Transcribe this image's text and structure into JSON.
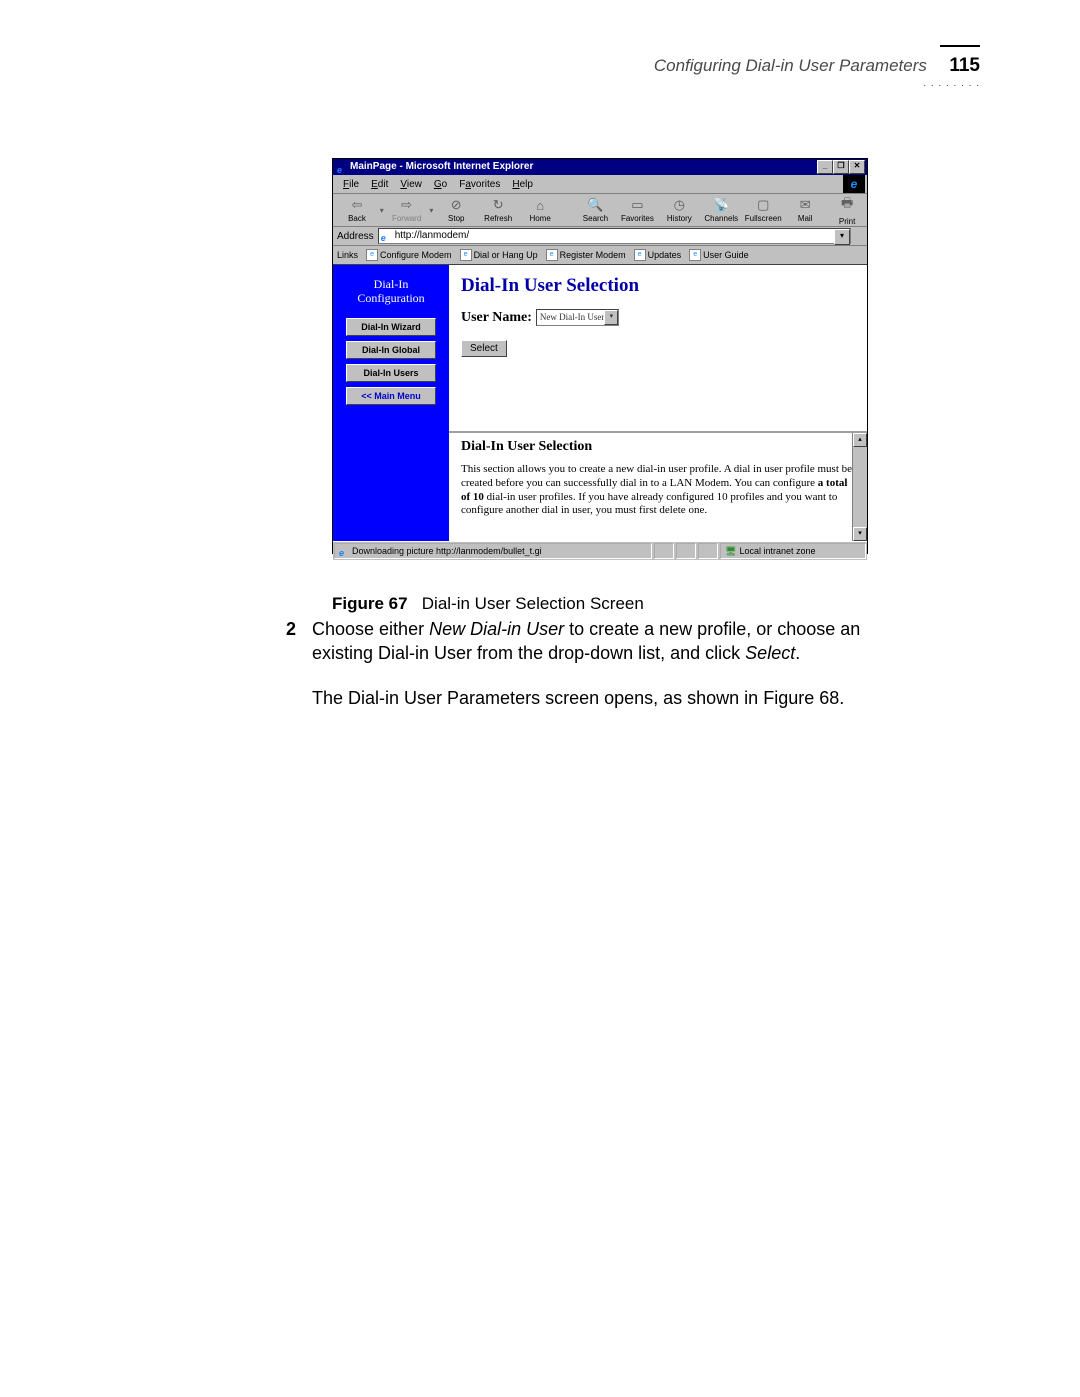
{
  "header": {
    "label": "Configuring Dial-in User Parameters",
    "page_number": "115"
  },
  "browser": {
    "title": "MainPage - Microsoft Internet Explorer",
    "menus": [
      "File",
      "Edit",
      "View",
      "Go",
      "Favorites",
      "Help"
    ],
    "toolbar": {
      "back": "Back",
      "forward": "Forward",
      "stop": "Stop",
      "refresh": "Refresh",
      "home": "Home",
      "search": "Search",
      "favorites": "Favorites",
      "history": "History",
      "channels": "Channels",
      "fullscreen": "Fullscreen",
      "mail": "Mail",
      "print": "Print"
    },
    "address": {
      "label": "Address",
      "value": "http://lanmodem/"
    },
    "links": {
      "label": "Links",
      "items": [
        "Configure Modem",
        "Dial or Hang Up",
        "Register Modem",
        "Updates",
        "User Guide"
      ]
    },
    "sidebar": {
      "title_line1": "Dial-In",
      "title_line2": "Configuration",
      "buttons": {
        "wizard": "Dial-In Wizard",
        "global": "Dial-In Global",
        "users": "Dial-In Users",
        "main": "<<  Main Menu"
      }
    },
    "main": {
      "heading": "Dial-In User Selection",
      "username_label": "User Name:",
      "username_value": "New Dial-In User",
      "select_button": "Select"
    },
    "lower": {
      "heading": "Dial-In User Selection",
      "text_part1": "This section allows you to create a new dial-in user profile. A dial in user profile must be created before you can successfully dial in to a LAN Modem. You can configure ",
      "text_bold": "a total of 10",
      "text_part2": " dial-in user profiles. If you have already configured 10 profiles and you want to configure another dial in user, you must first delete one."
    },
    "status": {
      "left": "Downloading picture http://lanmodem/bullet_t.gi",
      "right": "Local intranet zone"
    }
  },
  "caption": {
    "fig": "Figure 67",
    "text": "Dial-in User Selection Screen"
  },
  "body": {
    "step": "2",
    "p1a": "Choose either ",
    "p1_i1": "New Dial-in User",
    "p1b": " to create a new profile, or choose an existing Dial-in User from the drop-down list, and click ",
    "p1_i2": "Select",
    "p1c": ".",
    "p2": "The Dial-in User Parameters screen opens, as shown in Figure 68."
  }
}
